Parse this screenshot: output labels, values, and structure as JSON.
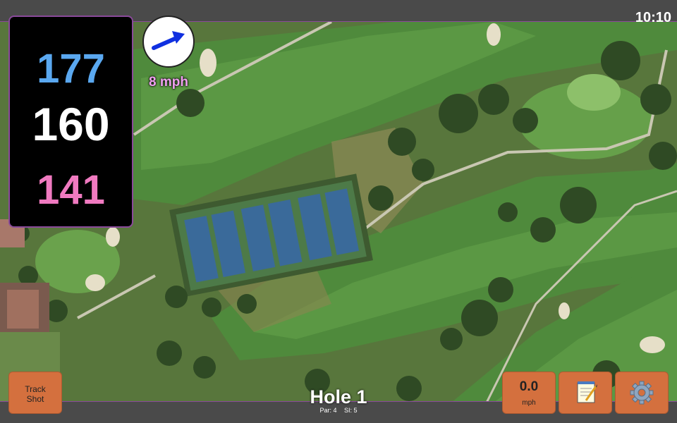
{
  "status_bar": {
    "time": "10:10"
  },
  "distances": {
    "back": "177",
    "center": "160",
    "front": "141"
  },
  "wind": {
    "speed_label": "8 mph",
    "icon": "wind-arrow-icon"
  },
  "track_shot": {
    "line1": "Track",
    "line2": "Shot"
  },
  "shot_speed": {
    "value": "0.0",
    "unit": "mph"
  },
  "notes": {
    "icon": "notepad-icon"
  },
  "settings": {
    "icon": "gear-icon"
  },
  "hole": {
    "title": "Hole 1",
    "par_label": "Par: 4",
    "si_label": "SI: 5"
  },
  "colors": {
    "back_distance": "#5aa8f0",
    "center_distance": "#ffffff",
    "front_distance": "#f07ac0",
    "button": "#d4703e",
    "wind_label": "#f0a0f0"
  }
}
